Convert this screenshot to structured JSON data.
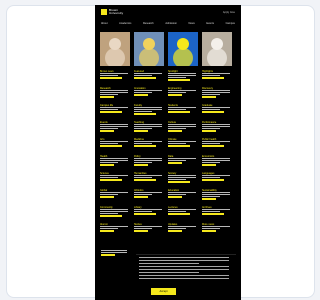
{
  "header": {
    "logo_text": "Brown University",
    "top_links": "Apply Give"
  },
  "nav": {
    "items": [
      "About",
      "Academics",
      "Research",
      "Admission",
      "News",
      "Events",
      "Campus"
    ]
  },
  "hero_images": [
    {
      "name": "hero-portrait-1",
      "bg": "#bfa27e",
      "accent": "#e9d8c4"
    },
    {
      "name": "hero-portrait-2",
      "bg": "#6f8fb8",
      "accent": "#f1d25c"
    },
    {
      "name": "hero-portrait-3",
      "bg": "#1c64c7",
      "accent": "#f5e81c"
    },
    {
      "name": "hero-portrait-4",
      "bg": "#b8ae9f",
      "accent": "#f4f0ea"
    }
  ],
  "columns": [
    {
      "cells": [
        {
          "title": "Brown news",
          "lines": 2
        },
        {
          "title": "Research",
          "lines": 3
        },
        {
          "title": "Campus life",
          "lines": 2
        },
        {
          "title": "Events",
          "lines": 3
        },
        {
          "title": "Arts",
          "lines": 2
        },
        {
          "title": "Health",
          "lines": 3
        },
        {
          "title": "Science",
          "lines": 2
        },
        {
          "title": "Global",
          "lines": 2
        },
        {
          "title": "Community",
          "lines": 3
        },
        {
          "title": "Alumni",
          "lines": 2
        }
      ]
    },
    {
      "cells": [
        {
          "title": "Featured",
          "lines": 2
        },
        {
          "title": "Innovation",
          "lines": 2
        },
        {
          "title": "Faculty",
          "lines": 3
        },
        {
          "title": "Teaching",
          "lines": 3
        },
        {
          "title": "Medicine",
          "lines": 2
        },
        {
          "title": "Policy",
          "lines": 3
        },
        {
          "title": "Humanities",
          "lines": 2
        },
        {
          "title": "Athletics",
          "lines": 2
        },
        {
          "title": "Library",
          "lines": 2
        },
        {
          "title": "Stories",
          "lines": 2
        }
      ]
    },
    {
      "cells": [
        {
          "title": "Spotlight",
          "lines": 3
        },
        {
          "title": "Engineering",
          "lines": 2
        },
        {
          "title": "Students",
          "lines": 2
        },
        {
          "title": "Culture",
          "lines": 3
        },
        {
          "title": "Climate",
          "lines": 2
        },
        {
          "title": "Data",
          "lines": 2
        },
        {
          "title": "Society",
          "lines": 3
        },
        {
          "title": "Education",
          "lines": 2
        },
        {
          "title": "Lectures",
          "lines": 2
        },
        {
          "title": "Updates",
          "lines": 2
        }
      ]
    },
    {
      "cells": [
        {
          "title": "Highlights",
          "lines": 2
        },
        {
          "title": "Discovery",
          "lines": 3
        },
        {
          "title": "Graduate",
          "lines": 2
        },
        {
          "title": "Performance",
          "lines": 3
        },
        {
          "title": "Public health",
          "lines": 2
        },
        {
          "title": "Economics",
          "lines": 3
        },
        {
          "title": "Languages",
          "lines": 2
        },
        {
          "title": "Sustainability",
          "lines": 3
        },
        {
          "title": "Archives",
          "lines": 2
        },
        {
          "title": "More news",
          "lines": 2
        }
      ]
    }
  ],
  "cookie_banner": {
    "lines": 8,
    "accept_label": "Accept"
  }
}
